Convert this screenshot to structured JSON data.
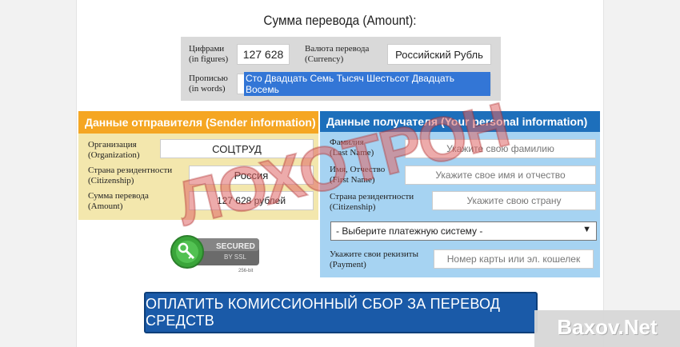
{
  "amount_section": {
    "heading": "Сумма перевода (Amount):",
    "figures_label_ru": "Цифрами",
    "figures_label_en": "(in figures)",
    "figures_value": "127 628",
    "currency_label_ru": "Валюта перевода",
    "currency_label_en": "(Currency)",
    "currency_value": "Российский Рубль",
    "words_label_ru": "Прописью",
    "words_label_en": "(in words)",
    "words_value": "Сто Двадцать Семь Тысяч Шестьсот Двадцать Восемь"
  },
  "sender": {
    "heading": "Данные отправителя (Sender information)",
    "org_label_ru": "Организация",
    "org_label_en": "(Organization)",
    "org_value": "СОЦТРУД",
    "citizenship_label_ru": "Страна резидентности",
    "citizenship_label_en": "(Citizenship)",
    "citizenship_value": "Россия",
    "amount_label_ru": "Сумма перевода",
    "amount_label_en": "(Amount)",
    "amount_value": "127 628 рублей"
  },
  "recipient": {
    "heading": "Данные получателя (Your personal information)",
    "last_name_label_ru": "Фамилия",
    "last_name_label_en": "(Last Name)",
    "last_name_placeholder": "Укажите свою фамилию",
    "first_name_label_ru": "Имя, Отчество",
    "first_name_label_en": "(First Name)",
    "first_name_placeholder": "Укажите свое имя и отчество",
    "citizenship_label_ru": "Страна резидентности",
    "citizenship_label_en": "(Citizenship)",
    "citizenship_placeholder": "Укажите свою страну",
    "payment_system_select": "- Выберите платежную систему -",
    "payment_label_ru": "Укажите свои рекизиты",
    "payment_label_en": "(Payment)",
    "payment_placeholder": "Номер карты или эл. кошелек"
  },
  "ssl_badge": {
    "line1": "SECURED",
    "line2": "BY SSL",
    "line3": "256-bit"
  },
  "pay_button": "ОПЛАТИТЬ КОМИССИОННЫЙ СБОР ЗА ПЕРЕВОД СРЕДСТВ",
  "stamp_text": "ЛОХОТРОН",
  "watermark_text": "Baxov.Net",
  "colors": {
    "sender_header": "#f5a623",
    "sender_body": "#f3e7ad",
    "recipient_header": "#1d6fbb",
    "recipient_body": "#a6d3f2",
    "button": "#1a5aa8"
  }
}
